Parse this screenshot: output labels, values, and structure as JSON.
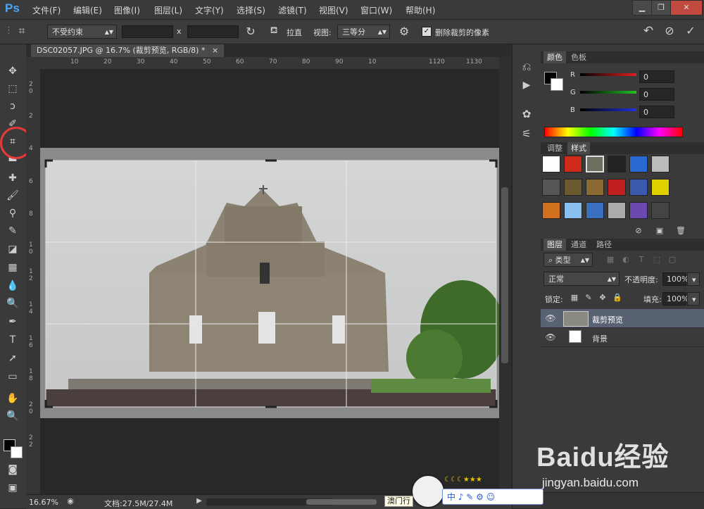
{
  "app": {
    "logo": "Ps"
  },
  "menu": [
    "文件(F)",
    "编辑(E)",
    "图像(I)",
    "图层(L)",
    "文字(Y)",
    "选择(S)",
    "滤镜(T)",
    "视图(V)",
    "窗口(W)",
    "帮助(H)"
  ],
  "window_controls": {
    "minimize": "▁",
    "restore": "❐",
    "close": "✕"
  },
  "options": {
    "constraint": "不受约束",
    "separator_x": "x",
    "straighten": "拉直",
    "view_label": "视图:",
    "view_value": "三等分",
    "delete_cropped": "删除裁剪的像素",
    "delete_cropped_checked": true
  },
  "document": {
    "tab_title": "DSC02057.JPG @ 16.7% (裁剪预览, RGB/8) *",
    "tab_close": "×",
    "ruler_h": [
      "10",
      "20",
      "30",
      "40",
      "50",
      "60",
      "70",
      "80",
      "90",
      "10",
      "1120",
      "1130"
    ],
    "ruler_v": [
      "2",
      "0",
      "2",
      "4",
      "6",
      "8",
      "1",
      "0",
      "1",
      "2",
      "1",
      "4",
      "1",
      "6",
      "1",
      "8",
      "2",
      "0",
      "2",
      "2"
    ]
  },
  "status": {
    "zoom": "16.67%",
    "doc_info": "文档:27.5M/27.4M"
  },
  "color_panel": {
    "tabs": [
      "颜色",
      "色板"
    ],
    "channels": [
      {
        "label": "R",
        "value": "0",
        "color": "#e02020"
      },
      {
        "label": "G",
        "value": "0",
        "color": "#20c020"
      },
      {
        "label": "B",
        "value": "0",
        "color": "#2030e0"
      }
    ]
  },
  "styles_panel": {
    "tabs": [
      "调整",
      "样式"
    ]
  },
  "layers_panel": {
    "tabs": [
      "图层",
      "通道",
      "路径"
    ],
    "filter_label": "类型",
    "blend_mode": "正常",
    "opacity_label": "不透明度:",
    "opacity_value": "100%",
    "lock_label": "锁定:",
    "fill_label": "填充:",
    "fill_value": "100%",
    "layers": [
      {
        "name": "裁剪预览",
        "selected": true
      },
      {
        "name": "背景",
        "selected": false
      }
    ]
  },
  "overlay": {
    "watermark": "Baidu经验",
    "watermark_url": "jingyan.baidu.com",
    "ime_label": "澳门行",
    "ime_icons": "中 ♪ ✎ ⚙ ☺"
  },
  "colors": {
    "accent": "#4aa7f5",
    "annotation": "#e83a3a"
  }
}
